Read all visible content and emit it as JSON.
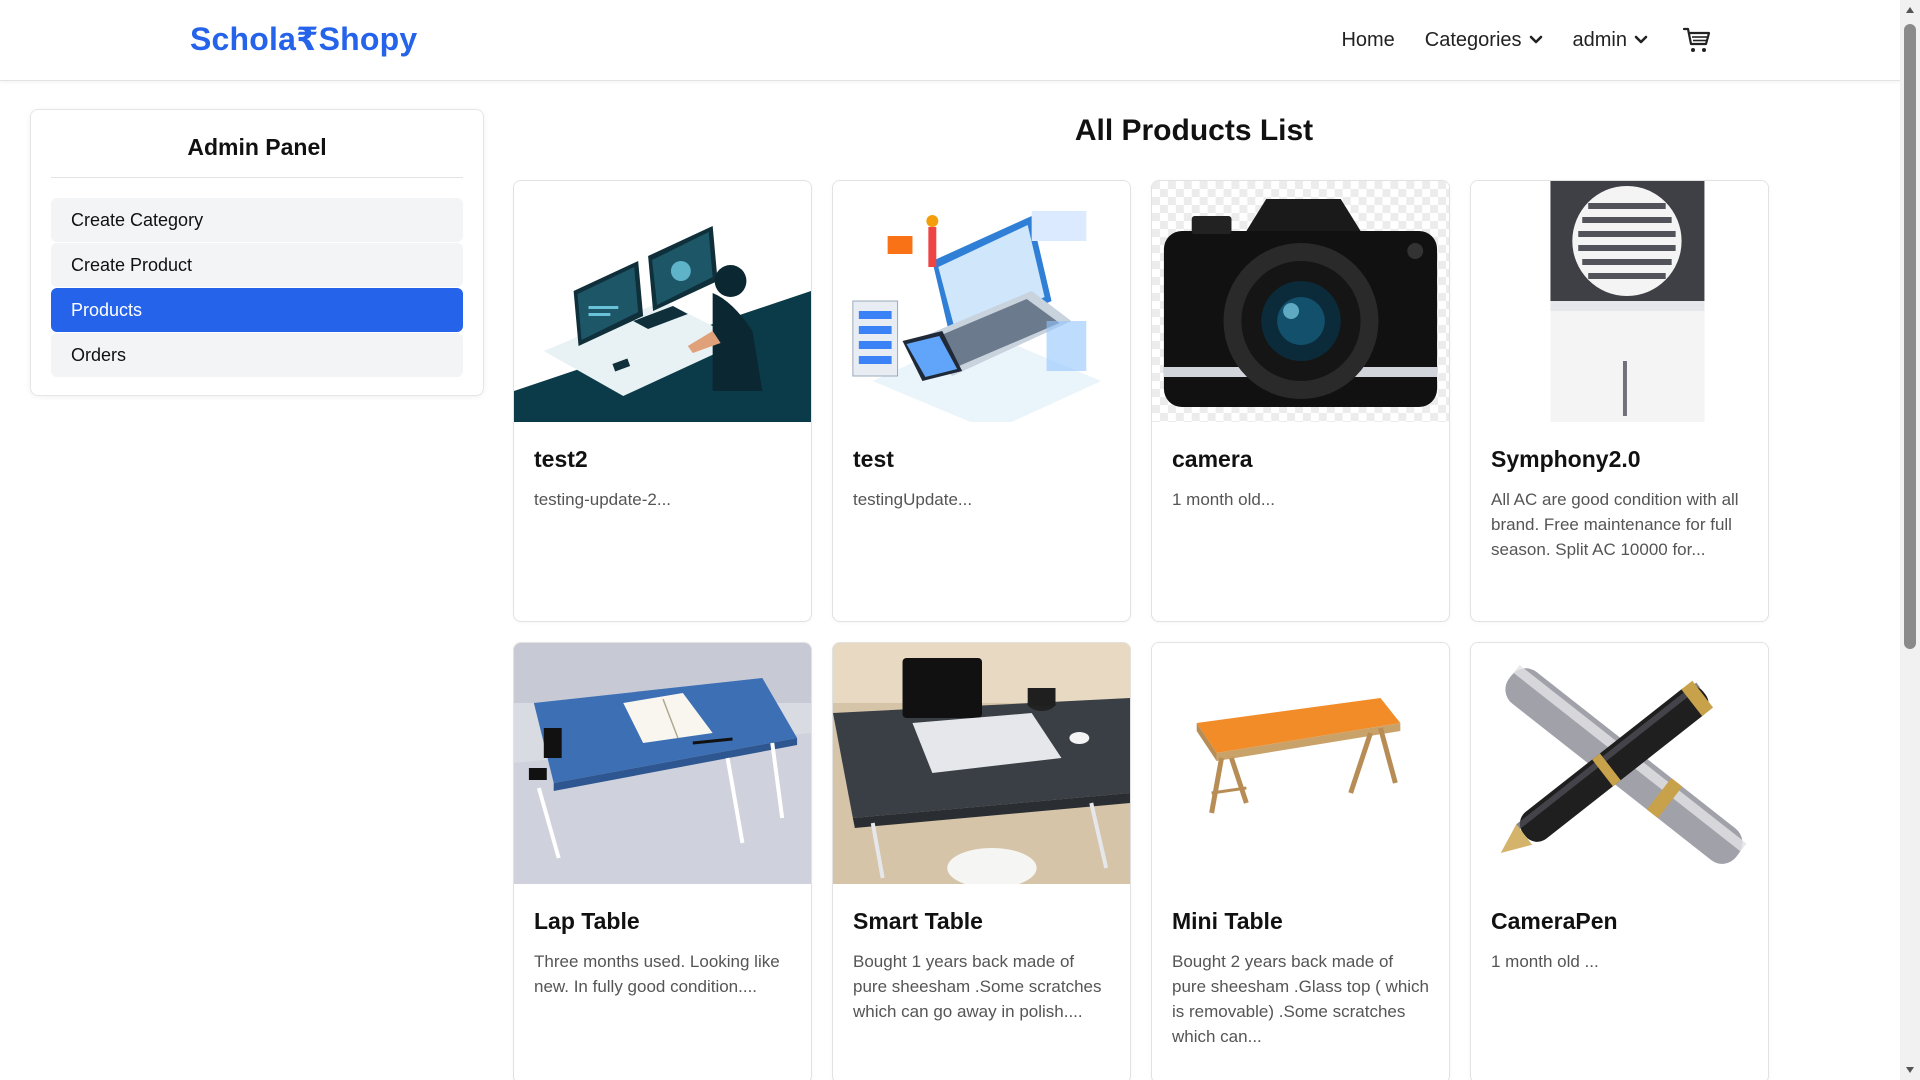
{
  "header": {
    "brand": "Schola₹Shopy",
    "nav": {
      "home": "Home",
      "categories": "Categories",
      "user": "admin"
    }
  },
  "sidebar": {
    "title": "Admin Panel",
    "items": [
      {
        "label": "Create Category"
      },
      {
        "label": "Create Product"
      },
      {
        "label": "Products"
      },
      {
        "label": "Orders"
      }
    ]
  },
  "main": {
    "title": "All Products List",
    "products": [
      {
        "name": "test2",
        "description": "testing-update-2..."
      },
      {
        "name": "test",
        "description": "testingUpdate..."
      },
      {
        "name": "camera",
        "description": "1 month old..."
      },
      {
        "name": "Symphony2.0",
        "description": "All AC are good condition with all brand. Free maintenance for full season. Split AC 10000 for..."
      },
      {
        "name": "Lap Table",
        "description": "Three months used. Looking like new. In fully good condition...."
      },
      {
        "name": "Smart Table",
        "description": "Bought 1 years back made of pure sheesham .Some scratches which can go away in polish...."
      },
      {
        "name": "Mini Table",
        "description": "Bought 2 years back made of pure sheesham .Glass top ( which is removable) .Some scratches which can..."
      },
      {
        "name": "CameraPen",
        "description": "1 month old ..."
      }
    ]
  },
  "colors": {
    "accent": "#2563eb",
    "sidebar_item_bg": "#f3f4f6"
  }
}
